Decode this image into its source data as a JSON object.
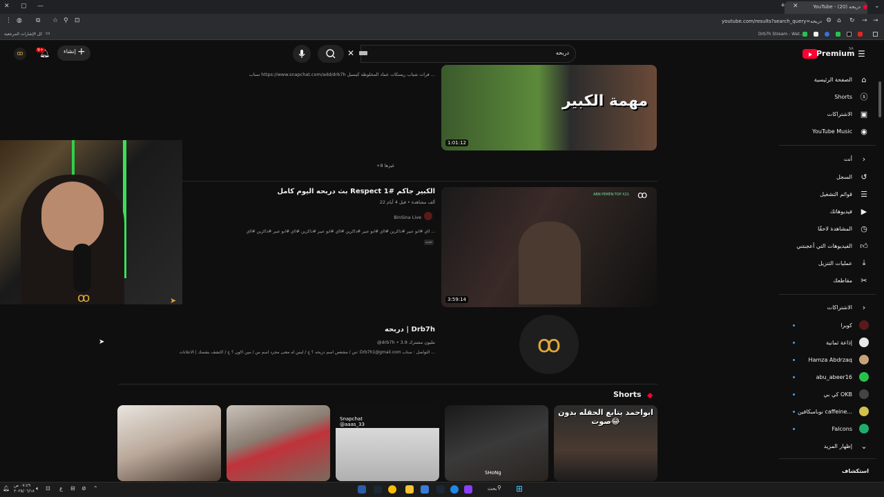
{
  "browser": {
    "tab_title": "YouTube - دربحه (20)",
    "url": "youtube.com/results?search_query=دربحه",
    "bookmark_left": "كل الإشارات المرجعية",
    "bookmark_right": "Drb7h Stream - Wat..."
  },
  "header": {
    "brand": "Premium",
    "brand_region": "SA",
    "search_value": "دربحه",
    "create_label": "إنشاء",
    "notif_count": "9+"
  },
  "sidebar": {
    "main": [
      {
        "label": "الصفحة الرئيسية",
        "icon": "home-icon"
      },
      {
        "label": "Shorts",
        "icon": "shorts-icon"
      },
      {
        "label": "الاشتراكات",
        "icon": "subscriptions-icon"
      },
      {
        "label": "YouTube Music",
        "icon": "music-icon"
      }
    ],
    "you_header": "أنت",
    "you": [
      {
        "label": "السجل",
        "icon": "history-icon"
      },
      {
        "label": "قوائم التشغيل",
        "icon": "playlist-icon"
      },
      {
        "label": "فيديوهاتك",
        "icon": "your-videos-icon"
      },
      {
        "label": "المشاهدة لاحقًا",
        "icon": "watch-later-icon"
      },
      {
        "label": "الفيديوهات التي أعجبتني",
        "icon": "like-icon"
      },
      {
        "label": "عمليات التنزيل",
        "icon": "download-icon"
      },
      {
        "label": "مقاطعك",
        "icon": "clips-icon"
      }
    ],
    "subs_header": "الاشتراكات",
    "subs": [
      {
        "label": "كوبرا",
        "color": "#5a1a1a"
      },
      {
        "label": "إذاعة ثمانية",
        "color": "#e8e8e8"
      },
      {
        "label": "Hamza Abdrzaq",
        "color": "#c8a27a"
      },
      {
        "label": "abu_abeer16",
        "color": "#27c24c"
      },
      {
        "label": "كي بي OKB",
        "color": "#444444"
      },
      {
        "label": "نوبامبكافين caffeine...",
        "color": "#d4c04a"
      },
      {
        "label": "Falcons",
        "color": "#1fae6a"
      }
    ],
    "show_more": "إظهار المزيد",
    "explore": "استكشاف"
  },
  "results": {
    "top_desc": "سناب https://www.snapchat.com/add/drb7h قرات شباب ريسكات عماد المخلوطه كيسبل ...",
    "top_duration": "1:01:12",
    "top_thumb_text": "مهمة الكبير",
    "more_label": "+8 غيرها",
    "video2_title": "بث دربحه اليوم كامل Respect الكبير جاكم #1",
    "video2_meta": "22 ألف مشاهدة • قبل 4 أيام",
    "video2_channel": "BinSina Live",
    "video2_desc": "ااي #ابو عبير #ذاكرين #ااي #ابو عبير #ذاكرين #ااي #ابو عبير #ذاكرين #ااي #ابو عبير #ذاكرين #ااي ...",
    "video2_duration": "3:59:14",
    "video2_badge": "جديد",
    "video2_overlay": "ABN-YEMEN-TOP X21",
    "channel_name": "دربحه | Drb7h",
    "channel_meta": "@drb7h • 3.9 مليون مشترك",
    "channel_desc": "س / مشعص اسم دربحه ؟ ج / ليس له معنى مجرد اسم س / مين اكون ؟ ج / اكتشف بنفسك | الاعلانات: Drb7h1@gmail.com التواصل : سناب ..."
  },
  "shorts": {
    "header": "Shorts",
    "items": [
      {
        "overlay": ""
      },
      {
        "overlay": ""
      },
      {
        "overlay": "Snapchat @aaas_33"
      },
      {
        "overlay": "SHoNg"
      },
      {
        "overlay": "ابواحمد يتابع الحقله بدون صوت😂"
      }
    ]
  },
  "taskbar": {
    "search_label": "بحث",
    "time": "٠٧:٤٩ ص",
    "date": "٢٠٢٥/٠٦/١٨"
  }
}
